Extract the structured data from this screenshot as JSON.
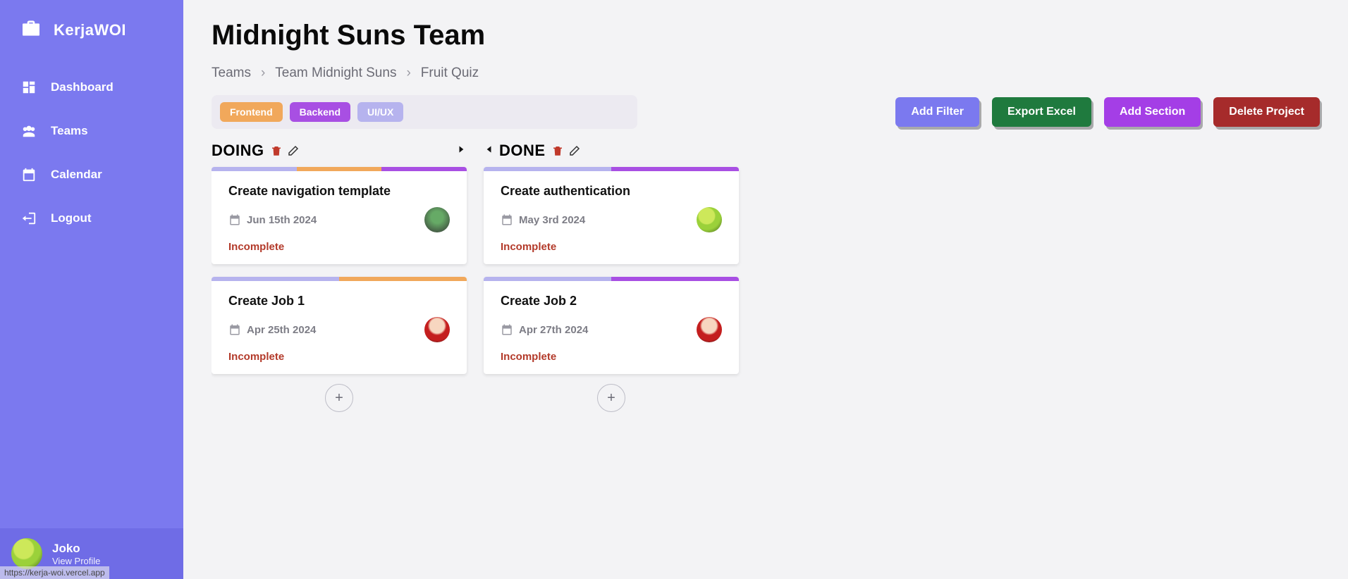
{
  "brand": {
    "title": "KerjaWOI"
  },
  "nav": {
    "items": [
      {
        "label": "Dashboard",
        "icon": "dashboard-icon"
      },
      {
        "label": "Teams",
        "icon": "teams-icon"
      },
      {
        "label": "Calendar",
        "icon": "calendar-icon"
      },
      {
        "label": "Logout",
        "icon": "logout-icon"
      }
    ]
  },
  "profile": {
    "name": "Joko",
    "link": "View Profile"
  },
  "hover_url": "https://kerja-woi.vercel.app",
  "page": {
    "title": "Midnight Suns Team"
  },
  "breadcrumb": [
    "Teams",
    "Team Midnight Suns",
    "Fruit Quiz"
  ],
  "filters": [
    {
      "label": "Frontend",
      "color": "orange"
    },
    {
      "label": "Backend",
      "color": "purple"
    },
    {
      "label": "UI/UX",
      "color": "lilac"
    }
  ],
  "actions": {
    "add_filter": "Add Filter",
    "export_excel": "Export Excel",
    "add_section": "Add Section",
    "delete_project": "Delete Project"
  },
  "columns": [
    {
      "title": "DOING",
      "cards": [
        {
          "title": "Create navigation template",
          "date": "Jun 15th 2024",
          "status": "Incomplete",
          "stripes": [
            "lilac",
            "orange",
            "purple"
          ],
          "avatar": "av1"
        },
        {
          "title": "Create Job 1",
          "date": "Apr 25th 2024",
          "status": "Incomplete",
          "stripes": [
            "lilac",
            "orange"
          ],
          "avatar": "av3"
        }
      ]
    },
    {
      "title": "DONE",
      "cards": [
        {
          "title": "Create authentication",
          "date": "May 3rd 2024",
          "status": "Incomplete",
          "stripes": [
            "lilac",
            "purple"
          ],
          "avatar": "av2"
        },
        {
          "title": "Create Job 2",
          "date": "Apr 27th 2024",
          "status": "Incomplete",
          "stripes": [
            "lilac",
            "purple"
          ],
          "avatar": "av3"
        }
      ]
    }
  ],
  "icons": {
    "trash_color": "#c0392b",
    "edit_color": "#333"
  }
}
